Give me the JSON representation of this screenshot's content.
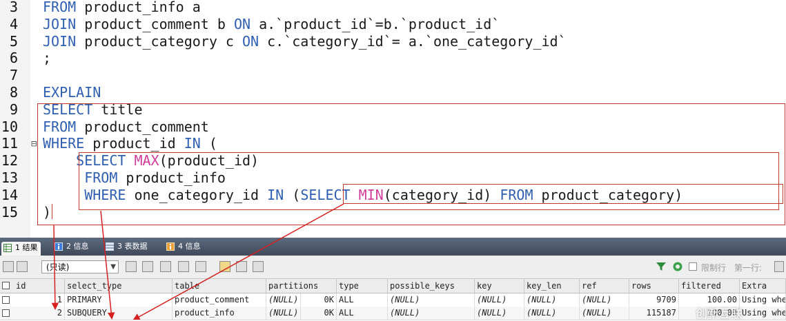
{
  "editor": {
    "line_numbers": [
      "3",
      "4",
      "5",
      "6",
      "7",
      "8",
      "9",
      "10",
      "11",
      "12",
      "13",
      "14",
      "15"
    ],
    "lines": [
      {
        "indent": "",
        "tokens": [
          {
            "t": "FROM",
            "k": "kw"
          },
          {
            "t": " product_info a",
            "k": ""
          }
        ]
      },
      {
        "indent": "",
        "tokens": [
          {
            "t": "JOIN",
            "k": "kw"
          },
          {
            "t": " product_comment b ",
            "k": ""
          },
          {
            "t": "ON",
            "k": "kw"
          },
          {
            "t": " a.`product_id`=b.`product_id`",
            "k": ""
          }
        ]
      },
      {
        "indent": "",
        "tokens": [
          {
            "t": "JOIN",
            "k": "kw"
          },
          {
            "t": " product_category c ",
            "k": ""
          },
          {
            "t": "ON",
            "k": "kw"
          },
          {
            "t": " c.`category_id`= a.`one_category_id`",
            "k": ""
          }
        ]
      },
      {
        "indent": "",
        "tokens": [
          {
            "t": ";",
            "k": ""
          }
        ]
      },
      {
        "indent": "",
        "tokens": []
      },
      {
        "indent": "",
        "tokens": [
          {
            "t": "EXPLAIN",
            "k": "kw"
          }
        ]
      },
      {
        "indent": "",
        "tokens": [
          {
            "t": "SELECT",
            "k": "kw"
          },
          {
            "t": " title",
            "k": ""
          }
        ]
      },
      {
        "indent": "",
        "tokens": [
          {
            "t": "FROM",
            "k": "kw"
          },
          {
            "t": " product_comment",
            "k": ""
          }
        ]
      },
      {
        "indent": "",
        "tokens": [
          {
            "t": "WHERE",
            "k": "kw"
          },
          {
            "t": " product_id ",
            "k": ""
          },
          {
            "t": "IN",
            "k": "kw"
          },
          {
            "t": " (",
            "k": ""
          }
        ]
      },
      {
        "indent": "    ",
        "tokens": [
          {
            "t": "SELECT",
            "k": "kw"
          },
          {
            "t": " ",
            "k": ""
          },
          {
            "t": "MAX",
            "k": "fn"
          },
          {
            "t": "(product_id)",
            "k": ""
          }
        ]
      },
      {
        "indent": "     ",
        "tokens": [
          {
            "t": "FROM",
            "k": "kw"
          },
          {
            "t": " product_info",
            "k": ""
          }
        ]
      },
      {
        "indent": "     ",
        "tokens": [
          {
            "t": "WHERE",
            "k": "kw"
          },
          {
            "t": " one_category_id ",
            "k": ""
          },
          {
            "t": "IN",
            "k": "kw"
          },
          {
            "t": " (",
            "k": ""
          },
          {
            "t": "SELECT",
            "k": "kw"
          },
          {
            "t": " ",
            "k": ""
          },
          {
            "t": "MIN",
            "k": "fn"
          },
          {
            "t": "(category_id) ",
            "k": ""
          },
          {
            "t": "FROM",
            "k": "kw"
          },
          {
            "t": " product_category)",
            "k": ""
          }
        ]
      },
      {
        "indent": "",
        "tokens": [
          {
            "t": ")",
            "k": ""
          }
        ]
      }
    ],
    "fold_marker": "⊟"
  },
  "tabs": [
    {
      "label": "1 结果",
      "active": true,
      "icon": "grid-icon"
    },
    {
      "label": "2 信息",
      "active": false,
      "icon": "info-icon"
    },
    {
      "label": "3 表数据",
      "active": false,
      "icon": "table-icon"
    },
    {
      "label": "4 信息",
      "active": false,
      "icon": "info-icon"
    }
  ],
  "toolbar": {
    "mode_select": "(只读)",
    "limit_label": "限制行",
    "first_row_label": "第一行:"
  },
  "grid": {
    "columns": [
      "id",
      "select_type",
      "table",
      "partitions",
      "type",
      "possible_keys",
      "key",
      "key_len",
      "ref",
      "rows",
      "filtered",
      "Extra"
    ],
    "rows": [
      {
        "id": "1",
        "select_type": "PRIMARY",
        "table": "product_comment",
        "partitions": "(NULL)",
        "size": "0K",
        "type": "ALL",
        "possible_keys": "(NULL)",
        "key": "(NULL)",
        "key_len": "(NULL)",
        "ref": "(NULL)",
        "rows": "9709",
        "filtered": "100.00",
        "Extra": "Using whe"
      },
      {
        "id": "2",
        "select_type": "SUBQUERY",
        "table": "product_info",
        "partitions": "(NULL)",
        "size": "0K",
        "type": "ALL",
        "possible_keys": "(NULL)",
        "key": "(NULL)",
        "key_len": "(NULL)",
        "ref": "(NULL)",
        "rows": "115187",
        "filtered": "100.00",
        "Extra": "Using whe"
      }
    ]
  },
  "watermark": "创新互联",
  "colors": {
    "keyword": "#2f5fb0",
    "function": "#d23c9a",
    "annotation": "#c0392b"
  }
}
